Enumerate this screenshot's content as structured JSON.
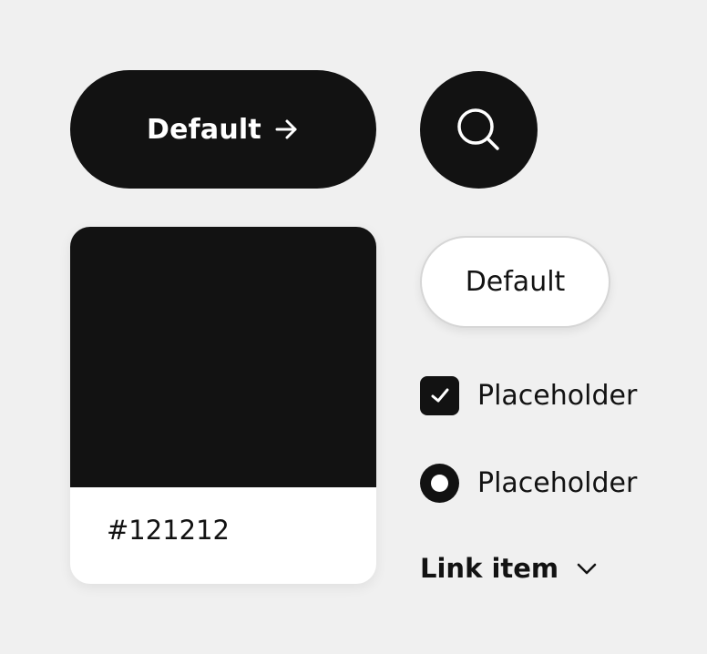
{
  "colors": {
    "background": "#f0f0f0",
    "primary": "#121212",
    "surface": "#ffffff",
    "border": "#d6d6d6"
  },
  "primary_button": {
    "label": "Default",
    "icon": "arrow-right-icon"
  },
  "search_button": {
    "icon": "search-icon"
  },
  "color_swatch": {
    "hex_label": "#121212"
  },
  "secondary_button": {
    "label": "Default"
  },
  "checkbox": {
    "label": "Placeholder",
    "checked": true,
    "icon": "checkmark-icon"
  },
  "radio": {
    "label": "Placeholder",
    "selected": true
  },
  "link_item": {
    "label": "Link item",
    "icon": "chevron-down-icon"
  }
}
